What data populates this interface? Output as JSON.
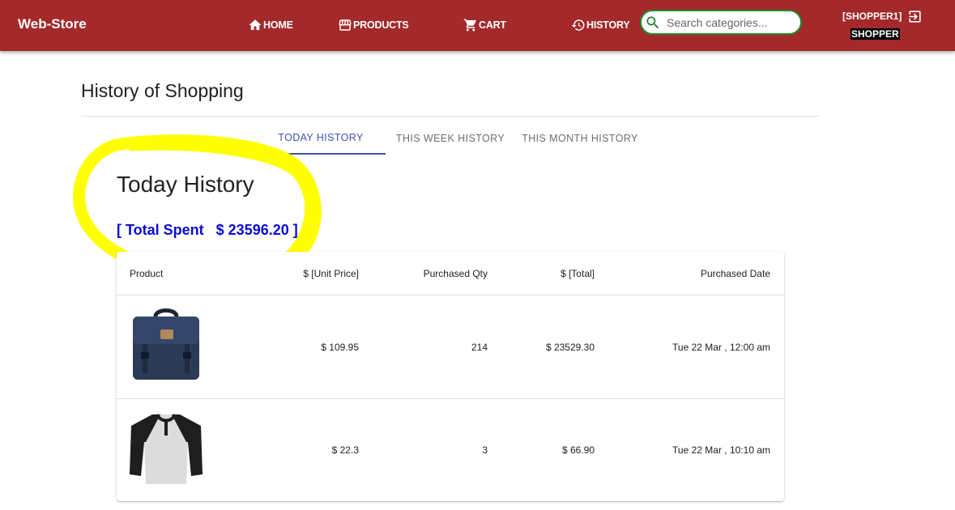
{
  "app": {
    "brand": "Web-Store"
  },
  "nav": {
    "home": "HOME",
    "products": "PRODUCTS",
    "cart": "CART",
    "history": "HISTORY"
  },
  "search": {
    "placeholder": "Search categories..."
  },
  "user": {
    "name": "[SHOPPER1]",
    "role": "SHOPPER"
  },
  "page": {
    "title": "History of Shopping"
  },
  "tabs": [
    {
      "label": "TODAY HISTORY",
      "active": true
    },
    {
      "label": "THIS WEEK HISTORY",
      "active": false
    },
    {
      "label": "THIS MONTH HISTORY",
      "active": false
    }
  ],
  "section": {
    "heading": "Today History",
    "total_spent": "[ Total Spent   $ 23596.20 ]"
  },
  "table": {
    "headers": [
      "Product",
      "$ [Unit Price]",
      "Purchased Qty",
      "$ [Total]",
      "Purchased Date"
    ],
    "rows": [
      {
        "product_icon": "backpack-image",
        "unit_price": "$ 109.95",
        "qty": "214",
        "total": "$ 23529.30",
        "date": "Tue 22 Mar , 12:00 am"
      },
      {
        "product_icon": "raglan-shirt-image",
        "unit_price": "$ 22.3",
        "qty": "3",
        "total": "$ 66.90",
        "date": "Tue 22 Mar , 10:10 am"
      }
    ]
  },
  "colors": {
    "appbar": "#a3292a",
    "search_border": "#1d8c2b",
    "tab_active": "#3f51b5",
    "total_spent": "#0a0ad8",
    "highlight": "#ffff00"
  }
}
